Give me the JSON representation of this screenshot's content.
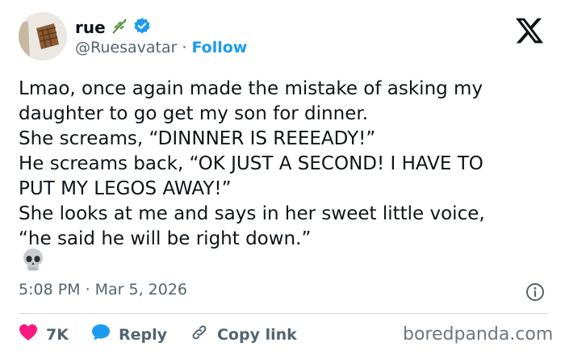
{
  "author": {
    "name": "rue",
    "handle": "@Ruesavatar",
    "separator": "·",
    "follow_label": "Follow"
  },
  "tweet": {
    "lines": [
      "Lmao, once again made the mistake of asking my",
      "daughter to go get my son for dinner.",
      "She screams, “DINNNER IS REEEADY!”",
      "He screams back, “OK JUST A SECOND! I HAVE TO",
      "PUT MY LEGOS AWAY!”",
      "She looks at me and says in her sweet little voice,",
      "“he said he will be right down.”"
    ],
    "emoji": "skull-emoji"
  },
  "meta": {
    "time": "5:08 PM",
    "separator": "·",
    "date": "Mar 5, 2026"
  },
  "actions": {
    "likes": "7K",
    "reply_label": "Reply",
    "copy_label": "Copy link"
  },
  "source": "boredpanda.com",
  "colors": {
    "accent": "#1d9bf0",
    "like": "#f91880",
    "muted": "#536471",
    "text": "#0f1419"
  }
}
